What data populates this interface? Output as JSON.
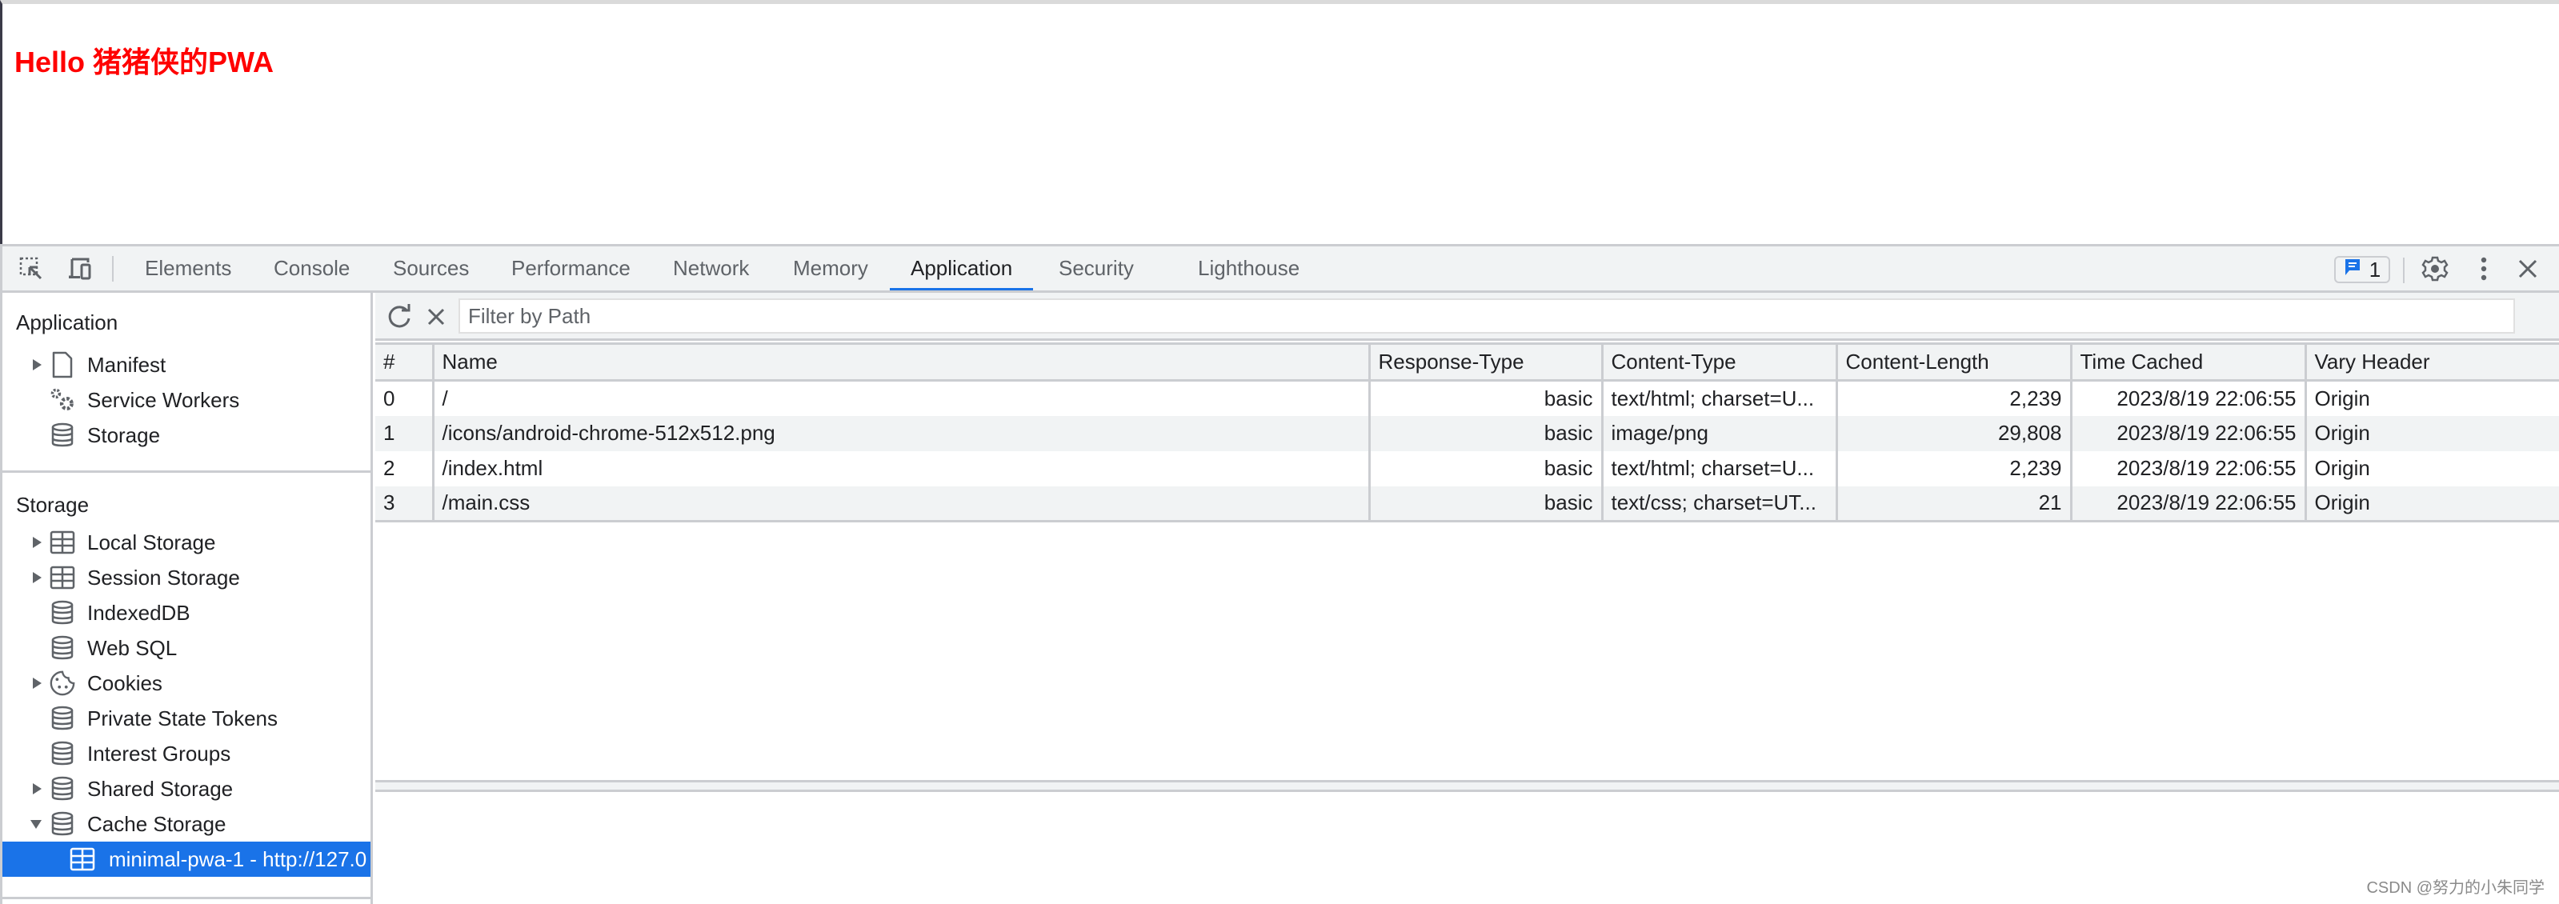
{
  "page": {
    "heading": "Hello 猪猪侠的PWA",
    "heading_color": "#ff0000"
  },
  "devtools": {
    "toolbar": {
      "inspect_icon": "inspect-element-icon",
      "device_icon": "device-toolbar-icon",
      "tabs": [
        {
          "label": "Elements",
          "active": false
        },
        {
          "label": "Console",
          "active": false
        },
        {
          "label": "Sources",
          "active": false
        },
        {
          "label": "Performance",
          "active": false
        },
        {
          "label": "Network",
          "active": false
        },
        {
          "label": "Memory",
          "active": false
        },
        {
          "label": "Application",
          "active": true
        },
        {
          "label": "Security",
          "active": false
        },
        {
          "label": "Lighthouse",
          "active": false
        }
      ],
      "issues_count": "1",
      "accent_color": "#1a73e8"
    },
    "sidebar": {
      "application_heading": "Application",
      "application_items": [
        {
          "label": "Manifest",
          "icon": "document-icon",
          "expandable": true
        },
        {
          "label": "Service Workers",
          "icon": "gears-icon",
          "expandable": false
        },
        {
          "label": "Storage",
          "icon": "database-icon",
          "expandable": false
        }
      ],
      "storage_heading": "Storage",
      "storage_items": [
        {
          "label": "Local Storage",
          "icon": "table-icon",
          "expandable": true,
          "expanded": false
        },
        {
          "label": "Session Storage",
          "icon": "table-icon",
          "expandable": true,
          "expanded": false
        },
        {
          "label": "IndexedDB",
          "icon": "database-icon",
          "expandable": false
        },
        {
          "label": "Web SQL",
          "icon": "database-icon",
          "expandable": false
        },
        {
          "label": "Cookies",
          "icon": "cookie-icon",
          "expandable": true,
          "expanded": false
        },
        {
          "label": "Private State Tokens",
          "icon": "database-icon",
          "expandable": false
        },
        {
          "label": "Interest Groups",
          "icon": "database-icon",
          "expandable": false
        },
        {
          "label": "Shared Storage",
          "icon": "database-icon",
          "expandable": true,
          "expanded": false
        },
        {
          "label": "Cache Storage",
          "icon": "database-icon",
          "expandable": true,
          "expanded": true
        }
      ],
      "cache_entry": {
        "label": "minimal-pwa-1 - http://127.0",
        "icon": "table-icon",
        "selected": true
      }
    },
    "cache_view": {
      "filter_placeholder": "Filter by Path",
      "filter_value": "",
      "columns": [
        "#",
        "Name",
        "Response-Type",
        "Content-Type",
        "Content-Length",
        "Time Cached",
        "Vary Header"
      ],
      "rows": [
        {
          "index": "0",
          "name": "/",
          "response_type": "basic",
          "content_type": "text/html; charset=U...",
          "content_length": "2,239",
          "time_cached": "2023/8/19 22:06:55",
          "vary_header": "Origin"
        },
        {
          "index": "1",
          "name": "/icons/android-chrome-512x512.png",
          "response_type": "basic",
          "content_type": "image/png",
          "content_length": "29,808",
          "time_cached": "2023/8/19 22:06:55",
          "vary_header": "Origin"
        },
        {
          "index": "2",
          "name": "/index.html",
          "response_type": "basic",
          "content_type": "text/html; charset=U...",
          "content_length": "2,239",
          "time_cached": "2023/8/19 22:06:55",
          "vary_header": "Origin"
        },
        {
          "index": "3",
          "name": "/main.css",
          "response_type": "basic",
          "content_type": "text/css; charset=UT...",
          "content_length": "21",
          "time_cached": "2023/8/19 22:06:55",
          "vary_header": "Origin"
        }
      ]
    }
  },
  "watermark": "CSDN @努力的小朱同学"
}
